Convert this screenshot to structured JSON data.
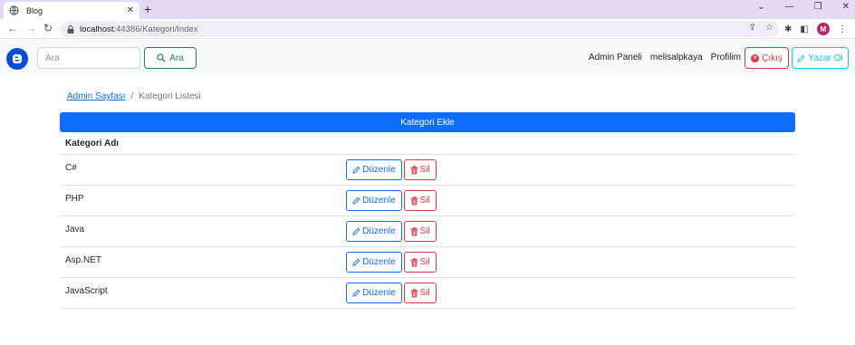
{
  "browser": {
    "tab_title": "Blog",
    "url_host": "localhost",
    "url_path": ":44386/Kategori/Index",
    "profile_initial": "M"
  },
  "navbar": {
    "search_placeholder": "Ara",
    "search_button": "Ara",
    "links": [
      "Admin Paneli",
      "melisalpkaya",
      "Profilim"
    ],
    "logout_button": "Çıkış",
    "writer_button": "Yazar Ol"
  },
  "breadcrumb": {
    "parent": "Admin Sayfası",
    "separator": "/",
    "current": "Kategori Listesi"
  },
  "add_button": "Kategori Ekle",
  "table": {
    "header": "Kategori Adı",
    "edit_label": "Düzenle",
    "delete_label": "Sil",
    "rows": [
      "C#",
      "PHP",
      "Java",
      "Asp.NET",
      "JavaScript"
    ]
  },
  "colors": {
    "primary": "#0d6efd",
    "danger": "#dc3545",
    "success": "#198754",
    "info": "#0dcaf0",
    "tabstrip": "#e3d9f4"
  }
}
